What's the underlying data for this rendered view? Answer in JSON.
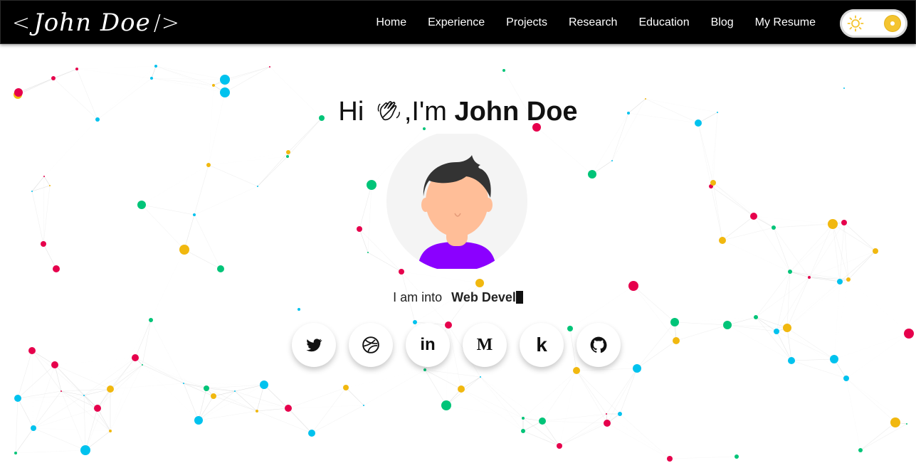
{
  "nav": {
    "brand": {
      "text": "John Doe",
      "left": "<",
      "right": "/>"
    },
    "links": [
      "Home",
      "Experience",
      "Projects",
      "Research",
      "Education",
      "Blog",
      "My Resume"
    ]
  },
  "theme_toggle": {
    "mode": "light",
    "sun_icon": "sun-icon",
    "knob_color": "#f4c430"
  },
  "hero": {
    "greeting_hi": "Hi",
    "greeting_im": ",I'm",
    "name": "John Doe",
    "wave_icon": "waving-hand-icon",
    "subtitle_prefix": "I am into",
    "typed_text": "Web Devel"
  },
  "socials": [
    {
      "icon": "twitter-icon"
    },
    {
      "icon": "dribbble-icon"
    },
    {
      "icon": "linkedin-icon",
      "glyph": "in"
    },
    {
      "icon": "medium-icon",
      "glyph": "M"
    },
    {
      "icon": "kaggle-icon",
      "glyph": "k"
    },
    {
      "icon": "github-icon"
    }
  ],
  "colors": {
    "navbar": "#000000",
    "particles": [
      "#e6004c",
      "#00c2ee",
      "#f1b80f",
      "#00c478"
    ],
    "avatar_shirt": "#8b00ff",
    "avatar_skin": "#ffbe98",
    "avatar_hair": "#333333"
  }
}
